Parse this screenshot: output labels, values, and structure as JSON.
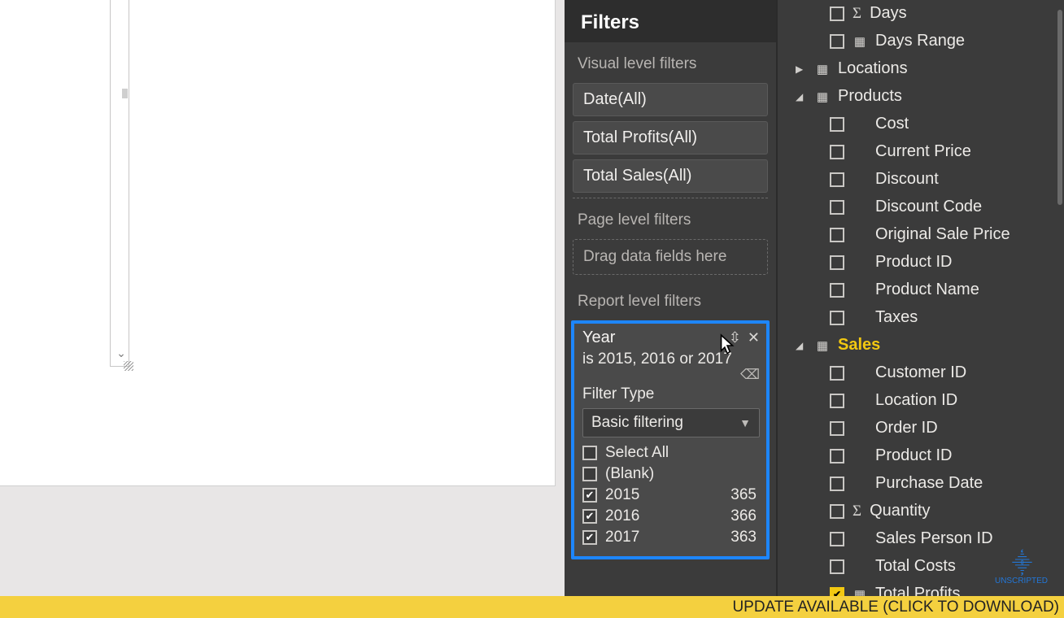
{
  "filters": {
    "title": "Filters",
    "visual_level_label": "Visual level filters",
    "visual_items": [
      {
        "label": "Date(All)"
      },
      {
        "label": "Total Profits(All)"
      },
      {
        "label": "Total Sales(All)"
      }
    ],
    "page_level_label": "Page level filters",
    "drop_hint": "Drag data fields here",
    "report_level_label": "Report level filters",
    "year_filter": {
      "title": "Year",
      "summary": "is 2015, 2016 or 2017",
      "filter_type_label": "Filter Type",
      "dropdown_value": "Basic filtering",
      "options": [
        {
          "label": "Select All",
          "checked": false,
          "count": ""
        },
        {
          "label": "(Blank)",
          "checked": false,
          "count": ""
        },
        {
          "label": "2015",
          "checked": true,
          "count": "365"
        },
        {
          "label": "2016",
          "checked": true,
          "count": "366"
        },
        {
          "label": "2017",
          "checked": true,
          "count": "363"
        }
      ]
    }
  },
  "fields": {
    "items": [
      {
        "type": "child",
        "checked": false,
        "icon": "sigma",
        "label": "Days"
      },
      {
        "type": "child",
        "checked": false,
        "icon": "table",
        "label": "Days Range"
      },
      {
        "type": "table",
        "expand": "collapsed",
        "label": "Locations"
      },
      {
        "type": "table",
        "expand": "expanded",
        "label": "Products"
      },
      {
        "type": "child",
        "checked": false,
        "icon": "",
        "label": "Cost"
      },
      {
        "type": "child",
        "checked": false,
        "icon": "",
        "label": "Current Price"
      },
      {
        "type": "child",
        "checked": false,
        "icon": "",
        "label": "Discount"
      },
      {
        "type": "child",
        "checked": false,
        "icon": "",
        "label": "Discount Code"
      },
      {
        "type": "child",
        "checked": false,
        "icon": "",
        "label": "Original Sale Price"
      },
      {
        "type": "child",
        "checked": false,
        "icon": "",
        "label": "Product ID"
      },
      {
        "type": "child",
        "checked": false,
        "icon": "",
        "label": "Product Name"
      },
      {
        "type": "child",
        "checked": false,
        "icon": "",
        "label": "Taxes"
      },
      {
        "type": "table",
        "expand": "expanded",
        "label": "Sales",
        "highlight": true
      },
      {
        "type": "child",
        "checked": false,
        "icon": "",
        "label": "Customer ID"
      },
      {
        "type": "child",
        "checked": false,
        "icon": "",
        "label": "Location ID"
      },
      {
        "type": "child",
        "checked": false,
        "icon": "",
        "label": "Order ID"
      },
      {
        "type": "child",
        "checked": false,
        "icon": "",
        "label": "Product ID"
      },
      {
        "type": "child",
        "checked": false,
        "icon": "",
        "label": "Purchase Date"
      },
      {
        "type": "child",
        "checked": false,
        "icon": "sigma",
        "label": "Quantity"
      },
      {
        "type": "child",
        "checked": false,
        "icon": "",
        "label": "Sales Person ID"
      },
      {
        "type": "child",
        "checked": false,
        "icon": "",
        "label": "Total Costs"
      },
      {
        "type": "child",
        "checked": true,
        "icon": "table",
        "label": "Total Profits"
      }
    ]
  },
  "update_bar": "UPDATE AVAILABLE (CLICK TO DOWNLOAD)",
  "watermark": "UNSCRIPTED"
}
